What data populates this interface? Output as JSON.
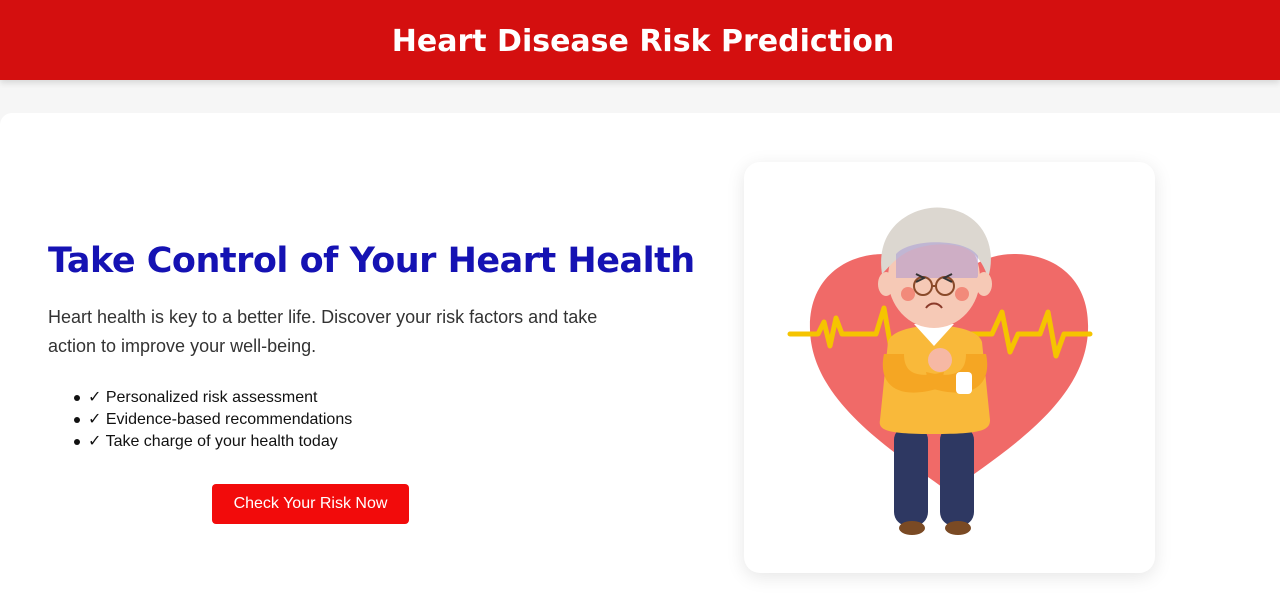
{
  "header": {
    "title": "Heart Disease Risk Prediction"
  },
  "hero": {
    "title": "Take Control of Your Heart Health",
    "description": "Heart health is key to a better life. Discover your risk factors and take action to improve your well-being.",
    "features": [
      "✓ Personalized risk assessment",
      "✓ Evidence-based recommendations",
      "✓ Take charge of your health today"
    ],
    "cta_label": "Check Your Risk Now"
  },
  "illustration": {
    "icon": "elderly-man-heart-pain-icon"
  },
  "colors": {
    "header_bg": "#d40f0f",
    "title": "#1512b3",
    "cta_bg": "#f20b0b",
    "heart": "#f06a68",
    "pulse": "#f5c400"
  }
}
